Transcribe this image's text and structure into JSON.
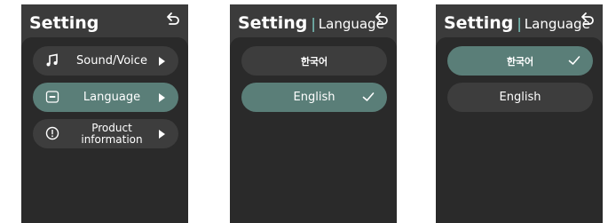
{
  "screens": [
    {
      "title": "Setting",
      "menu": [
        {
          "label": "Sound/Voice",
          "icon": "music-note-icon"
        },
        {
          "label": "Language",
          "icon": "abc-icon",
          "selected": true
        },
        {
          "label": "Product information",
          "icon": "info-icon"
        }
      ]
    },
    {
      "title": "Setting",
      "separator": "|",
      "subtitle": "Language",
      "languages": [
        {
          "label": "한국어",
          "selected": false
        },
        {
          "label": "English",
          "selected": true
        }
      ]
    },
    {
      "title": "Setting",
      "separator": "|",
      "subtitle": "Language",
      "languages": [
        {
          "label": "한국어",
          "selected": true
        },
        {
          "label": "English",
          "selected": false
        }
      ]
    }
  ],
  "colors": {
    "screen_bg": "#3b3b3b",
    "panel_bg": "#2a2a2a",
    "item_bg": "#3d3d3d",
    "selected_bg": "#5a7e78",
    "separator": "#7fd0c8"
  }
}
